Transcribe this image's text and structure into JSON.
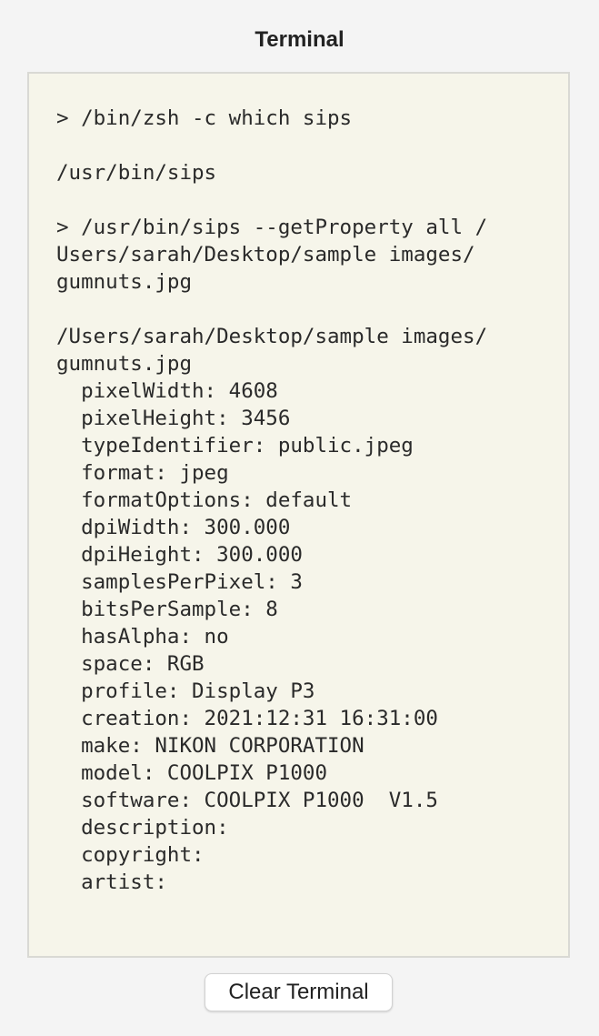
{
  "window": {
    "title": "Terminal"
  },
  "terminal": {
    "lines": [
      "> /bin/zsh -c which sips",
      "",
      "/usr/bin/sips",
      "",
      "> /usr/bin/sips --getProperty all /",
      "Users/sarah/Desktop/sample images/",
      "gumnuts.jpg",
      "",
      "/Users/sarah/Desktop/sample images/",
      "gumnuts.jpg",
      "  pixelWidth: 4608",
      "  pixelHeight: 3456",
      "  typeIdentifier: public.jpeg",
      "  format: jpeg",
      "  formatOptions: default",
      "  dpiWidth: 300.000",
      "  dpiHeight: 300.000",
      "  samplesPerPixel: 3",
      "  bitsPerSample: 8",
      "  hasAlpha: no",
      "  space: RGB",
      "  profile: Display P3",
      "  creation: 2021:12:31 16:31:00",
      "  make: NIKON CORPORATION",
      "  model: COOLPIX P1000",
      "  software: COOLPIX P1000  V1.5",
      "  description:",
      "  copyright:",
      "  artist:"
    ]
  },
  "actions": {
    "clear_label": "Clear Terminal"
  },
  "colors": {
    "terminal_background": "#f6f5ea",
    "terminal_border": "#d9d9d4",
    "window_background": "#f4f4f4"
  }
}
